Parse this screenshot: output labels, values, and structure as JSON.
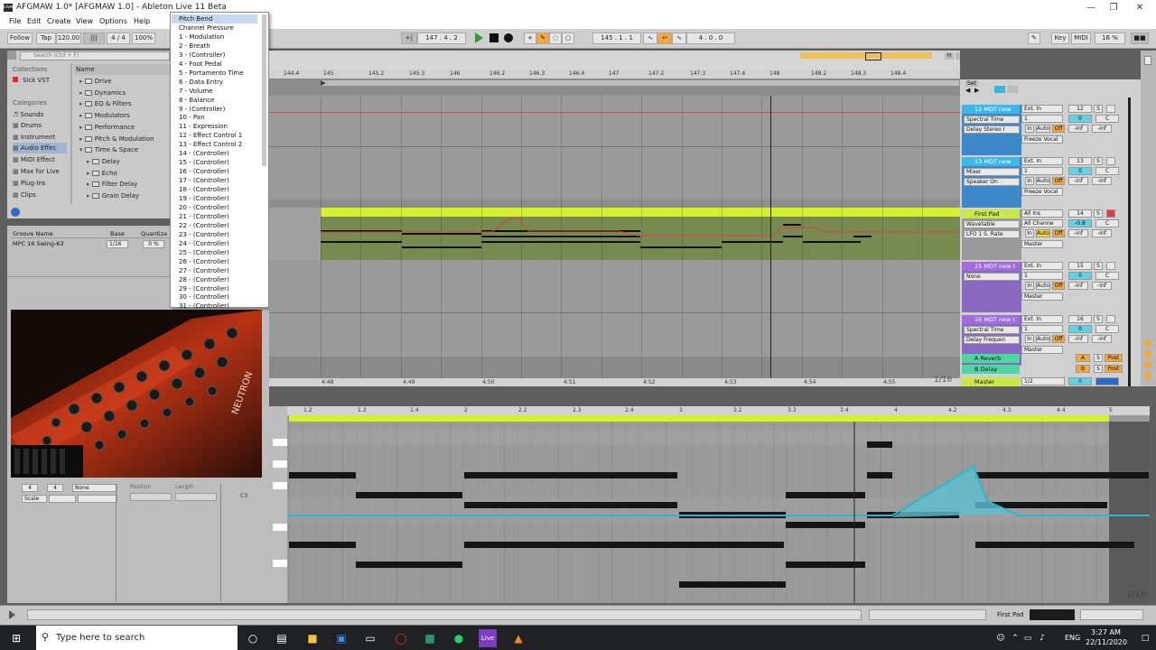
{
  "window": {
    "title": "AFGMAW 1.0* [AFGMAW 1.0] - Ableton Live 11 Beta",
    "logo": "Live"
  },
  "menubar": [
    "File",
    "Edit",
    "Create",
    "View",
    "Options",
    "Help"
  ],
  "transport": {
    "follow": "Follow",
    "tap": "Tap",
    "tempo": "120.00",
    "time_sig": "4 / 4",
    "zoom": "100%",
    "position": "147 . 4 . 2",
    "loop_start": "145 . 1 . 1",
    "loop_length": "4 . 0 . 0",
    "key": "Key",
    "midi": "MIDI",
    "cpu": "16 %"
  },
  "browser": {
    "search_placeholder": "Search (Ctrl + F)",
    "collections_label": "Collections",
    "collections": [
      "Sick VST"
    ],
    "categories_label": "Categories",
    "categories": [
      "Sounds",
      "Drums",
      "Instrument",
      "Audio Effec",
      "MIDI Effect",
      "Max for Live",
      "Plug-Ins",
      "Clips"
    ],
    "selected_category": "Audio Effec",
    "name_header": "Name",
    "items": [
      "Drive",
      "Dynamics",
      "EQ & Filters",
      "Modulators",
      "Performance",
      "Pitch & Modulation",
      "Time & Space",
      "Delay",
      "Echo",
      "Filter Delay",
      "Grain Delay"
    ]
  },
  "groove": {
    "header": "Groove Name",
    "base_label": "Base",
    "quantize_label": "Quantize",
    "name": "MPC 16 Swing-63",
    "base": "1/16",
    "quantize": "0 %"
  },
  "clip_props": {
    "sig_num": "4",
    "sig_den": "4",
    "groove": "None",
    "scale": "Scale",
    "position": "Position",
    "length": "Length"
  },
  "dropdown": {
    "selected": "Pitch Bend",
    "items": [
      "Pitch Bend",
      "Channel Pressure",
      "1 - Modulation",
      "2 - Breath",
      "3 - (Controller)",
      "4 - Foot Pedal",
      "5 - Portamento Time",
      "6 - Data Entry",
      "7 - Volume",
      "8 - Balance",
      "9 - (Controller)",
      "10 - Pan",
      "11 - Expression",
      "12 - Effect Control 1",
      "13 - Effect Control 2",
      "14 - (Controller)",
      "15 - (Controller)",
      "16 - (Controller)",
      "17 - (Controller)",
      "18 - (Controller)",
      "19 - (Controller)",
      "20 - (Controller)",
      "21 - (Controller)",
      "22 - (Controller)",
      "23 - (Controller)",
      "24 - (Controller)",
      "25 - (Controller)",
      "26 - (Controller)",
      "27 - (Controller)",
      "28 - (Controller)",
      "29 - (Controller)",
      "30 - (Controller)",
      "31 - (Controller)"
    ]
  },
  "arrangement": {
    "ruler": [
      "144.4",
      "145",
      "145.2",
      "145.3",
      "146",
      "146.2",
      "146.3",
      "146.4",
      "147",
      "147.2",
      "147.3",
      "147.4",
      "148",
      "148.2",
      "148.3",
      "148.4"
    ],
    "time_ruler": [
      "4:48",
      "4:49",
      "4:50",
      "4:51",
      "4:52",
      "4:53",
      "4:54",
      "4:55"
    ],
    "set_label": "Set",
    "quantize": "1/16"
  },
  "tracks": [
    {
      "name": "12 MDT new",
      "color": "#3fb6e8",
      "device": "Spectral Time",
      "param": "Delay Stereo I",
      "input": "Ext. In",
      "chan": "1",
      "freeze": "Freeze Vocal",
      "num": "12",
      "vol": "0",
      "pan": "C"
    },
    {
      "name": "13 MDT new",
      "color": "#3fb6e8",
      "device": "Mixer",
      "param": "Speaker On",
      "input": "Ext. In",
      "chan": "1",
      "freeze": "Freeze Vocal",
      "num": "13",
      "vol": "0",
      "pan": "C"
    },
    {
      "name": "First Pad",
      "color": "#c8e84a",
      "device": "Wavetable",
      "param": "LFO 1 S. Rate",
      "input": "All Ins",
      "chan": "All Channe",
      "freeze": "Master",
      "num": "14",
      "vol": "-0.8",
      "pan": "C"
    },
    {
      "name": "15 MDT new t",
      "color": "#a16ce0",
      "device": "None",
      "param": "",
      "input": "Ext. In",
      "chan": "1",
      "freeze": "Master",
      "num": "15",
      "vol": "0",
      "pan": "C"
    },
    {
      "name": "16 MDT new t",
      "color": "#a16ce0",
      "device": "Spectral Time",
      "param": "Delay Frequen",
      "input": "Ext. In",
      "chan": "1",
      "freeze": "Master",
      "num": "16",
      "vol": "0",
      "pan": "C"
    }
  ],
  "mixer_labels": {
    "in": "In",
    "auto": "Auto",
    "off": "Off",
    "inf": "-inf",
    "s": "S"
  },
  "returns": [
    {
      "name": "A Reverb",
      "letter": "A",
      "post": "Post"
    },
    {
      "name": "B Delay",
      "letter": "B",
      "post": "Post"
    },
    {
      "name": "Master",
      "letter": "0",
      "post": ""
    }
  ],
  "master_out": "1/2",
  "clip_editor": {
    "ruler": [
      "1.2",
      "1.3",
      "1.4",
      "2",
      "2.2",
      "2.3",
      "2.4",
      "3",
      "3.2",
      "3.3",
      "3.4",
      "4",
      "4.2",
      "4.3",
      "4.4",
      "5"
    ],
    "key_label": "C3",
    "quantize": "1/16"
  },
  "statusbar": {
    "track": "First Pad"
  },
  "taskbar": {
    "search_placeholder": "Type here to search",
    "time": "3:27 AM",
    "date": "22/11/2020",
    "lang": "ENG"
  }
}
